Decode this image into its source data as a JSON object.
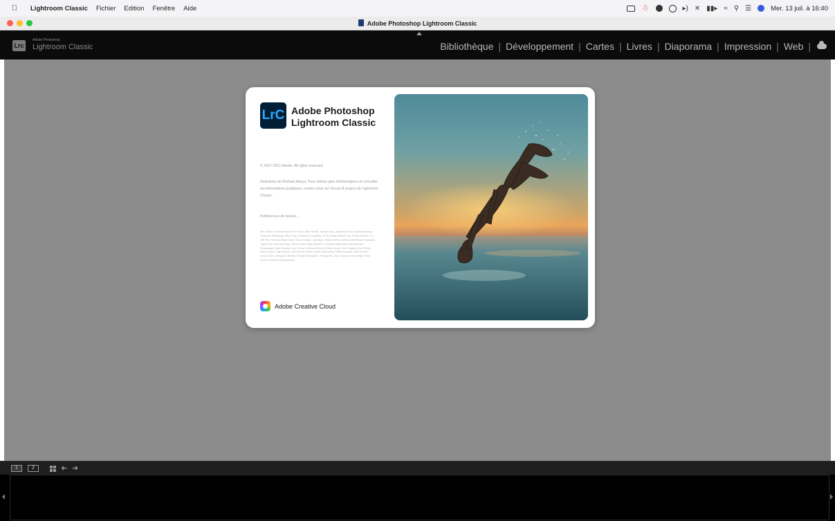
{
  "menubar": {
    "apple_icon": "apple-logo-icon",
    "items": [
      {
        "label": "Lightroom Classic"
      },
      {
        "label": "Fichier"
      },
      {
        "label": "Edition"
      },
      {
        "label": "Fenêtre"
      },
      {
        "label": "Aide"
      }
    ],
    "tray_icons": [
      "screen-share-icon",
      "bartender-icon",
      "creative-cloud-tray-icon",
      "record-icon",
      "volume-icon",
      "bluetooth-icon",
      "battery-icon",
      "wifi-icon",
      "spotlight-search-icon",
      "control-center-icon",
      "siri-icon"
    ],
    "clock": "Mer. 13 juil. à 16:40"
  },
  "window": {
    "title": "Adobe Photoshop Lightroom Classic"
  },
  "lightroom": {
    "logo": "Lrc",
    "brand_small": "Adobe Photoshop",
    "brand": "Lightroom Classic",
    "modules": [
      {
        "label": "Bibliothèque"
      },
      {
        "label": "Développement"
      },
      {
        "label": "Cartes"
      },
      {
        "label": "Livres"
      },
      {
        "label": "Diaporama"
      },
      {
        "label": "Impression"
      },
      {
        "label": "Web"
      }
    ]
  },
  "splash": {
    "logo": "LrC",
    "product_line1": "Adobe Photoshop",
    "product_line2": "Lightroom Classic",
    "copyright": "© 2007-2022 Adobe. All rights reserved.",
    "illustration": "Illustration de Michael Aboya. Pour obtenir plus d'informations et consulter les informations juridiques, rendez-vous sur l'écran À propos de Lightroom Classic.",
    "prefs": "Préférences de lecture...",
    "credits": "Ben Olsem, Thomas Knoll, Eric Chan, Max Wendt, Joshua Bury, Julieanne Kost, David Auyeung, Gopinath Srinivasan, Rikk Flohr, Samwell Choudhury, M W Sahay, Daniel Lee, Pavan Kumar T S, Jeff Tew, Krishna Singh Karki, Bruce Kaskel, Lisa Ngo, Vikash Mehta, Krishna Madhavan Sandeep, Tapas Dey, Ivan McLellan, Vishal Joshi, Vijay Sankar G, Harsha Mallineddy, Ramakumar Pushparaja, Nitin Sharma, Dan Gerber, Melissa Monroe, Brian Kruse, Tom Hogarty, Ben Zibble, Kelly Castro, Julie Kmoch, Jeff Van de Walker, Mark Soderberg, Ritika Dawalia, Kjetil Drarvik, Simon Chen, Benjamin Warde, Sharad Mangalick, Yuhong Wu, Jon Clauson, Ned Wright, Ravi Kumar, Srinivas Ramaswamy",
    "cc_label": "Adobe Creative Cloud"
  },
  "filmstrip": {
    "view1": "1",
    "view2": "2"
  }
}
